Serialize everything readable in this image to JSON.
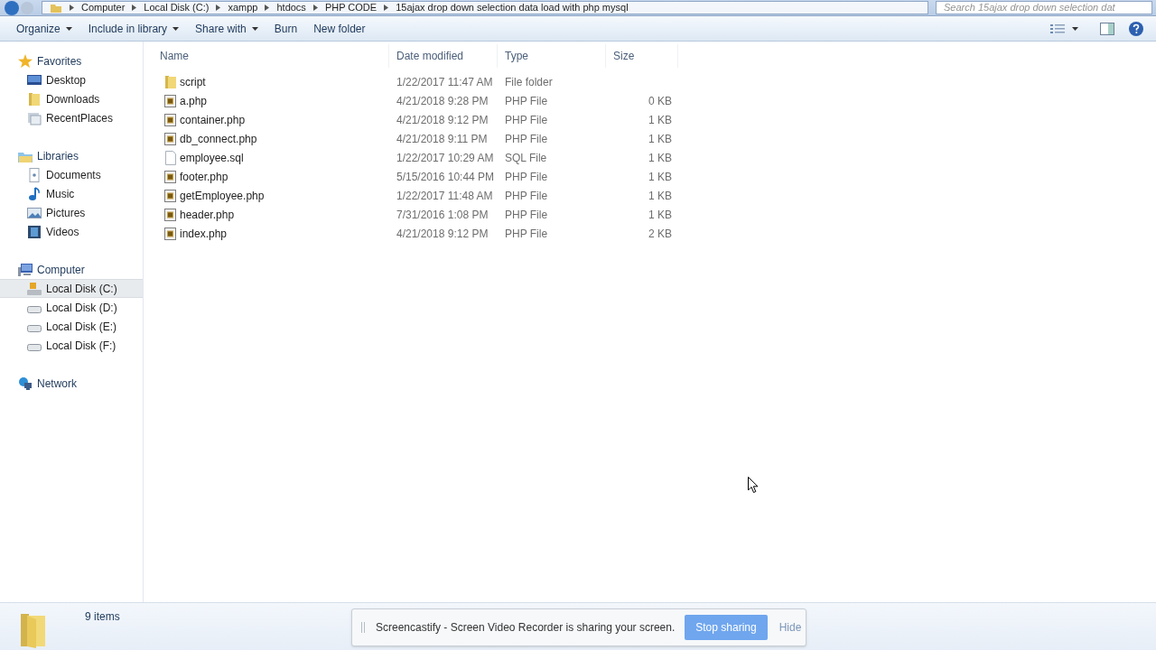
{
  "address_bar": {
    "breadcrumbs": [
      "Computer",
      "Local Disk (C:)",
      "xampp",
      "htdocs",
      "PHP CODE",
      "15ajax drop down selection data load with php mysql"
    ],
    "search_placeholder": "Search 15ajax drop down selection dat"
  },
  "toolbar": {
    "buttons": [
      {
        "label": "Organize",
        "dropdown": true
      },
      {
        "label": "Include in library",
        "dropdown": true
      },
      {
        "label": "Share with",
        "dropdown": true
      },
      {
        "label": "Burn",
        "dropdown": false
      },
      {
        "label": "New folder",
        "dropdown": false
      }
    ]
  },
  "sidebar": {
    "groups": [
      {
        "label": "Favorites",
        "kind": "favorites",
        "children": [
          {
            "label": "Desktop",
            "kind": "desktop",
            "selected": false
          },
          {
            "label": "Downloads",
            "kind": "folder",
            "selected": false
          },
          {
            "label": "RecentPlaces",
            "kind": "recent",
            "selected": false
          }
        ]
      },
      {
        "label": "Libraries",
        "kind": "libraries",
        "children": [
          {
            "label": "Documents",
            "kind": "documents",
            "selected": false
          },
          {
            "label": "Music",
            "kind": "music",
            "selected": false
          },
          {
            "label": "Pictures",
            "kind": "pictures",
            "selected": false
          },
          {
            "label": "Videos",
            "kind": "videos",
            "selected": false
          }
        ]
      },
      {
        "label": "Computer",
        "kind": "computer",
        "children": [
          {
            "label": "Local Disk (C:)",
            "kind": "system-disk",
            "selected": true
          },
          {
            "label": "Local Disk (D:)",
            "kind": "disk",
            "selected": false
          },
          {
            "label": "Local Disk (E:)",
            "kind": "disk",
            "selected": false
          },
          {
            "label": "Local Disk (F:)",
            "kind": "disk",
            "selected": false
          }
        ]
      },
      {
        "label": "Network",
        "kind": "network"
      }
    ]
  },
  "table": {
    "columns": [
      "Name",
      "Date modified",
      "Type",
      "Size"
    ],
    "rows": [
      {
        "name": "script",
        "kind": "folder",
        "date": "1/22/2017 11:47 AM",
        "type": "File folder"
      },
      {
        "name": "a.php",
        "kind": "php",
        "date": "4/21/2018 9:28 PM",
        "type": "PHP File",
        "size": "0 KB"
      },
      {
        "name": "container.php",
        "kind": "php",
        "date": "4/21/2018 9:12 PM",
        "type": "PHP File",
        "size": "1 KB"
      },
      {
        "name": "db_connect.php",
        "kind": "php",
        "date": "4/21/2018 9:11 PM",
        "type": "PHP File",
        "size": "1 KB"
      },
      {
        "name": "employee.sql",
        "kind": "plain",
        "date": "1/22/2017 10:29 AM",
        "type": "SQL File",
        "size": "1 KB"
      },
      {
        "name": "footer.php",
        "kind": "php",
        "date": "5/15/2016 10:44 PM",
        "type": "PHP File",
        "size": "1 KB"
      },
      {
        "name": "getEmployee.php",
        "kind": "php",
        "date": "1/22/2017 11:48 AM",
        "type": "PHP File",
        "size": "1 KB"
      },
      {
        "name": "header.php",
        "kind": "php",
        "date": "7/31/2016 1:08 PM",
        "type": "PHP File",
        "size": "1 KB"
      },
      {
        "name": "index.php",
        "kind": "php",
        "date": "4/21/2018 9:12 PM",
        "type": "PHP File",
        "size": "2 KB"
      }
    ]
  },
  "status_bar": {
    "item_count": "9 items"
  },
  "notification": {
    "message": "Screencastify - Screen Video Recorder is sharing your screen.",
    "primary_button": "Stop sharing",
    "secondary_button": "Hide"
  }
}
